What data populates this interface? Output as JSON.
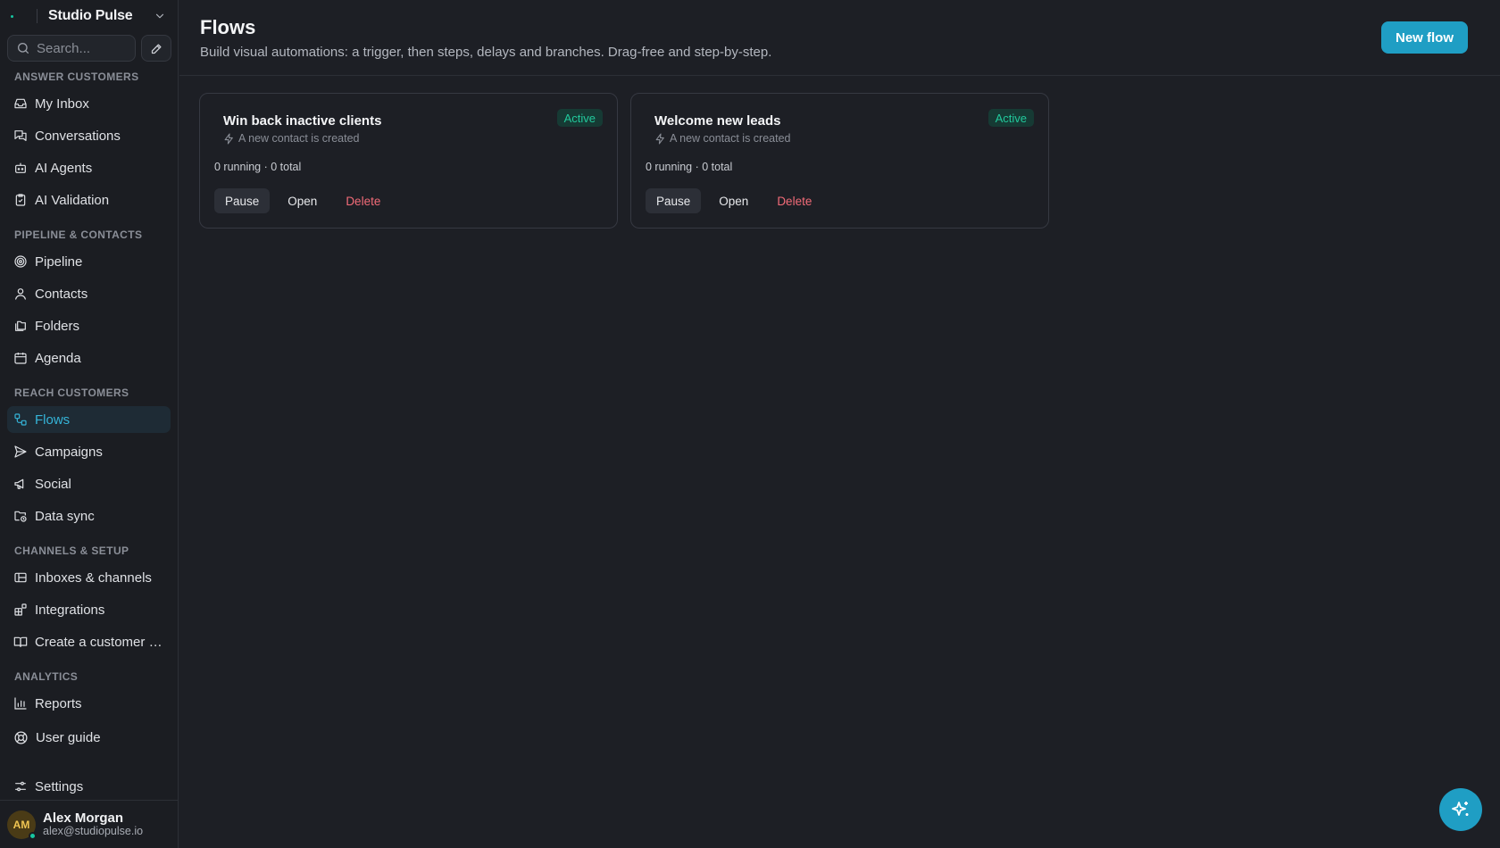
{
  "workspace": {
    "name": "Studio Pulse"
  },
  "search": {
    "placeholder": "Search..."
  },
  "sidebar": {
    "sections": [
      {
        "label": "ANSWER CUSTOMERS"
      },
      {
        "label": "PIPELINE & CONTACTS"
      },
      {
        "label": "REACH CUSTOMERS"
      },
      {
        "label": "CHANNELS & SETUP"
      },
      {
        "label": "ANALYTICS"
      }
    ],
    "items": [
      {
        "label": "My Inbox",
        "icon": "inbox-icon"
      },
      {
        "label": "Conversations",
        "icon": "conversations-icon"
      },
      {
        "label": "AI Agents",
        "icon": "bot-icon"
      },
      {
        "label": "AI Validation",
        "icon": "clipboard-check-icon"
      },
      {
        "label": "Pipeline",
        "icon": "target-icon"
      },
      {
        "label": "Contacts",
        "icon": "user-icon"
      },
      {
        "label": "Folders",
        "icon": "folders-icon"
      },
      {
        "label": "Agenda",
        "icon": "calendar-icon"
      },
      {
        "label": "Flows",
        "icon": "workflow-icon",
        "active": true
      },
      {
        "label": "Campaigns",
        "icon": "send-icon"
      },
      {
        "label": "Social",
        "icon": "megaphone-icon"
      },
      {
        "label": "Data sync",
        "icon": "folder-sync-icon"
      },
      {
        "label": "Inboxes & channels",
        "icon": "channels-icon"
      },
      {
        "label": "Integrations",
        "icon": "blocks-icon"
      },
      {
        "label": "Create a customer portal",
        "icon": "book-icon"
      },
      {
        "label": "Reports",
        "icon": "bar-chart-icon"
      },
      {
        "label": "User guide",
        "icon": "lifebuoy-icon"
      }
    ],
    "settings": {
      "label": "Settings",
      "icon": "sliders-icon"
    }
  },
  "user": {
    "initials": "AM",
    "name": "Alex Morgan",
    "email": "alex@studiopulse.io"
  },
  "page": {
    "title": "Flows",
    "subtitle": "Build visual automations: a trigger, then steps, delays and branches. Drag-free and step-by-step.",
    "new_button": "New flow"
  },
  "flows": [
    {
      "title": "Win back inactive clients",
      "trigger": "A new contact is created",
      "status": "Active",
      "stats": "0 running · 0 total",
      "actions": {
        "pause": "Pause",
        "open": "Open",
        "delete": "Delete"
      }
    },
    {
      "title": "Welcome new leads",
      "trigger": "A new contact is created",
      "status": "Active",
      "stats": "0 running · 0 total",
      "actions": {
        "pause": "Pause",
        "open": "Open",
        "delete": "Delete"
      }
    }
  ],
  "colors": {
    "accent": "#1f9ec4",
    "active_nav": "#35b4d8",
    "status_active": "#22c99c",
    "danger": "#f26b78",
    "background": "#1d1f25"
  }
}
